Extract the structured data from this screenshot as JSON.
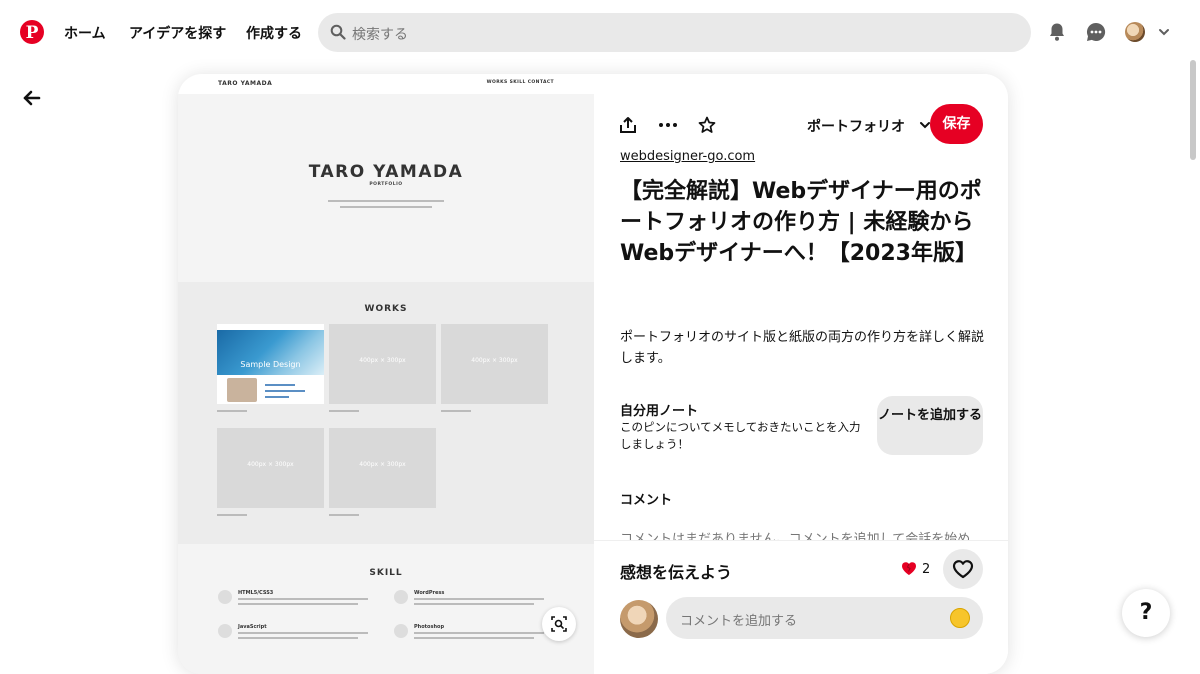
{
  "nav": {
    "home": "ホーム",
    "explore": "アイデアを探す",
    "create": "作成する",
    "search_placeholder": "検索する"
  },
  "pin_image": {
    "brand": "TARO YAMADA",
    "menu": "WORKS  SKILL  CONTACT",
    "hero_title": "TARO YAMADA",
    "hero_sub": "PORTFOLIO",
    "works_title": "WORKS",
    "thumb_label": "400px × 300px",
    "sample_label": "Sample Design",
    "skill_title": "SKILL",
    "skills": [
      "HTML5/CSS3",
      "WordPress",
      "JavaScript",
      "Photoshop"
    ]
  },
  "details": {
    "board_name": "ポートフォリオ",
    "save_label": "保存",
    "source": "webdesigner-go.com",
    "title": "【完全解説】Webデザイナー用のポートフォリオの作り方 | 未経験からWebデザイナーへ！【2023年版】",
    "description": "ポートフォリオのサイト版と紙版の両方の作り方を詳しく解説します。",
    "note_title": "自分用ノート",
    "note_text": "このピンについてメモしておきたいことを入力しましょう！",
    "note_button": "ノートを追加する",
    "comments_title": "コメント",
    "comments_empty": "コメントはまだありません。コメントを追加して会話を始め",
    "feedback_title": "感想を伝えよう",
    "reaction_count": "2",
    "comment_placeholder": "コメントを追加する"
  },
  "help_label": "?",
  "colors": {
    "brand": "#e60023",
    "input_bg": "#e9e9e9"
  }
}
